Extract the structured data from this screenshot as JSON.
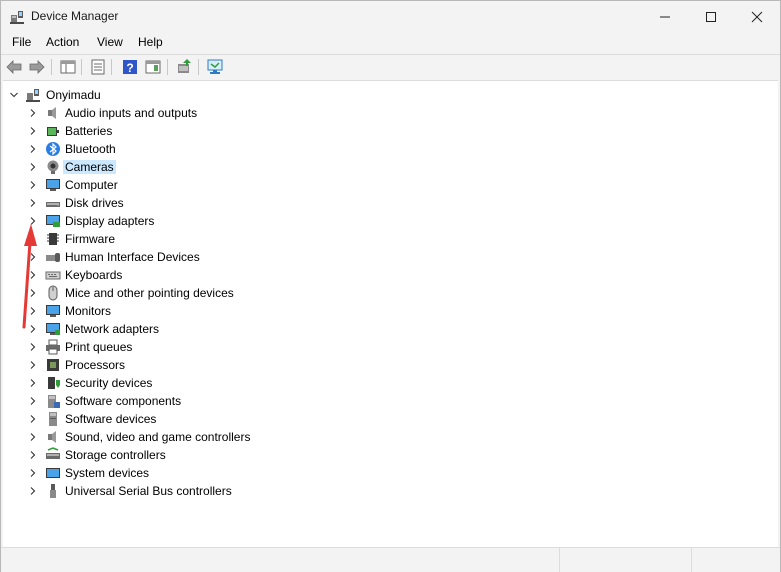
{
  "window": {
    "title": "Device Manager",
    "controls": [
      "minimize-icon",
      "maximize-icon",
      "close-icon"
    ]
  },
  "menu": {
    "file": "File",
    "action": "Action",
    "view": "View",
    "help": "Help"
  },
  "toolbar": {
    "icons": [
      "back-arrow-icon",
      "forward-arrow-icon",
      "show-hide-console-tree-icon",
      "properties-icon",
      "help-icon",
      "show-action-pane-icon",
      "update-driver-icon",
      "scan-hardware-icon"
    ]
  },
  "tree": {
    "root": {
      "label": "Onyimadu",
      "icon": "computer-tower-icon",
      "expanded": true
    },
    "categories": [
      {
        "label": "Audio inputs and outputs",
        "icon": "speaker-icon",
        "selected": false
      },
      {
        "label": "Batteries",
        "icon": "battery-icon",
        "selected": false
      },
      {
        "label": "Bluetooth",
        "icon": "bluetooth-icon",
        "selected": false
      },
      {
        "label": "Cameras",
        "icon": "camera-icon",
        "selected": true
      },
      {
        "label": "Computer",
        "icon": "monitor-icon",
        "selected": false
      },
      {
        "label": "Disk drives",
        "icon": "disk-drive-icon",
        "selected": false
      },
      {
        "label": "Display adapters",
        "icon": "display-adapter-icon",
        "selected": false
      },
      {
        "label": "Firmware",
        "icon": "chip-icon",
        "selected": false
      },
      {
        "label": "Human Interface Devices",
        "icon": "hid-icon",
        "selected": false
      },
      {
        "label": "Keyboards",
        "icon": "keyboard-icon",
        "selected": false
      },
      {
        "label": "Mice and other pointing devices",
        "icon": "mouse-icon",
        "selected": false
      },
      {
        "label": "Monitors",
        "icon": "monitor-icon",
        "selected": false
      },
      {
        "label": "Network adapters",
        "icon": "network-adapter-icon",
        "selected": false
      },
      {
        "label": "Print queues",
        "icon": "printer-icon",
        "selected": false
      },
      {
        "label": "Processors",
        "icon": "processor-icon",
        "selected": false
      },
      {
        "label": "Security devices",
        "icon": "security-device-icon",
        "selected": false
      },
      {
        "label": "Software components",
        "icon": "software-component-icon",
        "selected": false
      },
      {
        "label": "Software devices",
        "icon": "software-device-icon",
        "selected": false
      },
      {
        "label": "Sound, video and game controllers",
        "icon": "speaker-icon",
        "selected": false
      },
      {
        "label": "Storage controllers",
        "icon": "storage-controller-icon",
        "selected": false
      },
      {
        "label": "System devices",
        "icon": "system-device-icon",
        "selected": false
      },
      {
        "label": "Universal Serial Bus controllers",
        "icon": "usb-icon",
        "selected": false
      }
    ]
  },
  "colors": {
    "selection": "#cce8ff",
    "annotation_arrow": "#e53935",
    "window_bg": "#f3f3f3",
    "tree_bg": "#ffffff"
  }
}
